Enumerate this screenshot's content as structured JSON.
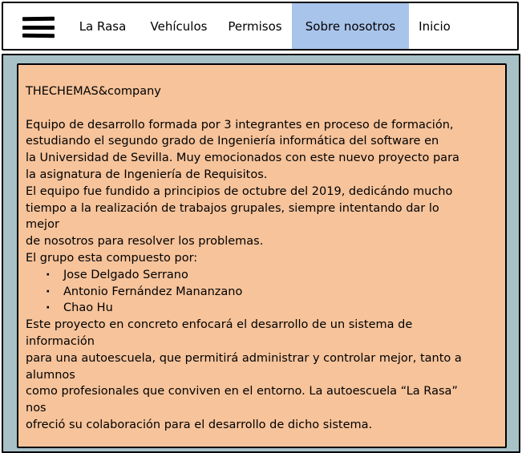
{
  "nav": {
    "items": [
      {
        "label": "La Rasa",
        "active": false
      },
      {
        "label": "Vehículos",
        "active": false
      },
      {
        "label": "Permisos",
        "active": false
      },
      {
        "label": "Sobre nosotros",
        "active": true
      },
      {
        "label": "Inicio",
        "active": false
      }
    ]
  },
  "about": {
    "company": "THECHEMAS&company",
    "lines": [
      "Equipo de desarrollo formada por 3 integrantes en proceso de formación,",
      "estudiando el segundo grado de Ingeniería informática del software en",
      "la Universidad de Sevilla. Muy emocionados con este nuevo proyecto para",
      "la asignatura de Ingeniería de Requisitos.",
      "El equipo fue fundido a principios de octubre del 2019, dedicándo mucho",
      "tiempo a la realización de trabajos grupales, siempre intentando dar lo",
      "mejor",
      "de nosotros para resolver los problemas.",
      "El grupo esta compuesto por:"
    ],
    "members": [
      "Jose Delgado Serrano",
      "Antonio Fernández Mananzano",
      "Chao Hu"
    ],
    "closing_lines": [
      "Este proyecto en concreto enfocará el desarrollo de un sistema de",
      "información",
      "para una autoescuela, que permitirá administrar y controlar mejor, tanto a",
      "alumnos",
      "como profesionales que conviven en el entorno. La autoescuela “La Rasa”",
      "nos",
      "ofreció su colaboración para el desarrollo de dicho sistema."
    ]
  }
}
